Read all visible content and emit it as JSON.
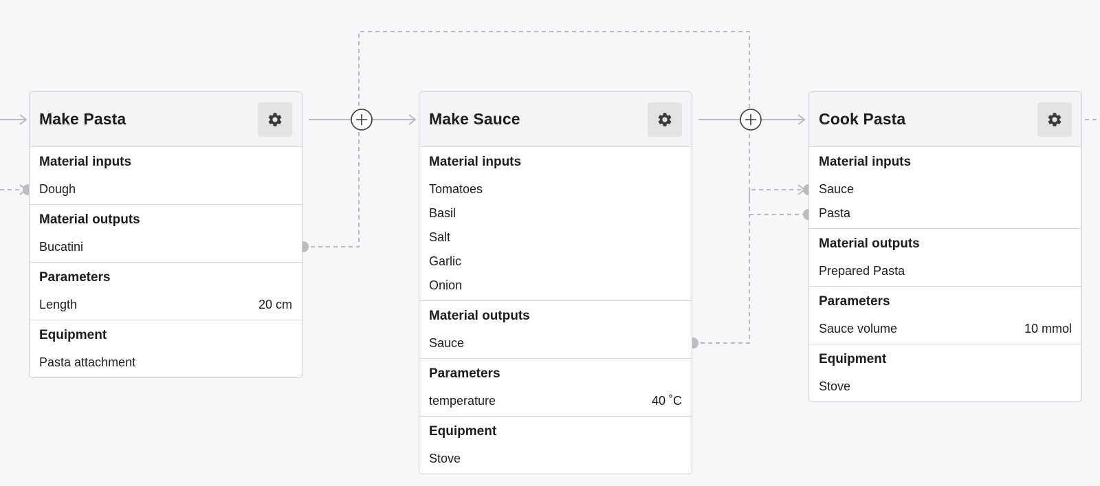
{
  "theme": {
    "connector_color": "#b9b9bd",
    "port_color": "#bcbcc0",
    "plus_stroke": "#3a3a3c",
    "gear_color": "#3a3a3c"
  },
  "nodes": [
    {
      "id": "make-pasta",
      "title": "Make Pasta",
      "gear_icon": "gear-icon",
      "sections": [
        {
          "title": "Material inputs",
          "items": [
            {
              "label": "Dough",
              "value": ""
            }
          ]
        },
        {
          "title": "Material outputs",
          "items": [
            {
              "label": "Bucatini",
              "value": ""
            }
          ]
        },
        {
          "title": "Parameters",
          "items": [
            {
              "label": "Length",
              "value": "20 cm"
            }
          ]
        },
        {
          "title": "Equipment",
          "items": [
            {
              "label": "Pasta attachment",
              "value": ""
            }
          ]
        }
      ]
    },
    {
      "id": "make-sauce",
      "title": "Make Sauce",
      "gear_icon": "gear-icon",
      "sections": [
        {
          "title": "Material inputs",
          "items": [
            {
              "label": "Tomatoes",
              "value": ""
            },
            {
              "label": "Basil",
              "value": ""
            },
            {
              "label": "Salt",
              "value": ""
            },
            {
              "label": "Garlic",
              "value": ""
            },
            {
              "label": "Onion",
              "value": ""
            }
          ]
        },
        {
          "title": "Material outputs",
          "items": [
            {
              "label": "Sauce",
              "value": ""
            }
          ]
        },
        {
          "title": "Parameters",
          "items": [
            {
              "label": "temperature",
              "value": "40 ˚C"
            }
          ]
        },
        {
          "title": "Equipment",
          "items": [
            {
              "label": "Stove",
              "value": ""
            }
          ]
        }
      ]
    },
    {
      "id": "cook-pasta",
      "title": "Cook Pasta",
      "gear_icon": "gear-icon",
      "sections": [
        {
          "title": "Material inputs",
          "items": [
            {
              "label": "Sauce",
              "value": ""
            },
            {
              "label": "Pasta",
              "value": ""
            }
          ]
        },
        {
          "title": "Material outputs",
          "items": [
            {
              "label": "Prepared Pasta",
              "value": ""
            }
          ]
        },
        {
          "title": "Parameters",
          "items": [
            {
              "label": "Sauce volume",
              "value": "10 mmol"
            }
          ]
        },
        {
          "title": "Equipment",
          "items": [
            {
              "label": "Stove",
              "value": ""
            }
          ]
        }
      ]
    }
  ]
}
